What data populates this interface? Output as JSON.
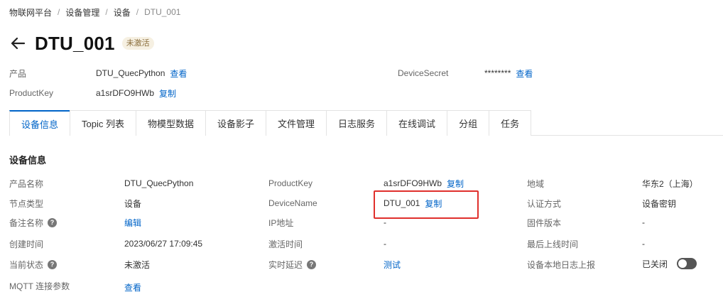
{
  "breadcrumb": [
    "物联网平台",
    "设备管理",
    "设备",
    "DTU_001"
  ],
  "header": {
    "title": "DTU_001",
    "status": "未激活"
  },
  "summary": {
    "product_label": "产品",
    "product_value": "DTU_QuecPython",
    "product_link": "查看",
    "productkey_label": "ProductKey",
    "productkey_value": "a1srDFO9HWb",
    "productkey_link": "复制",
    "secret_label": "DeviceSecret",
    "secret_value": "********",
    "secret_link": "查看"
  },
  "tabs": [
    "设备信息",
    "Topic 列表",
    "物模型数据",
    "设备影子",
    "文件管理",
    "日志服务",
    "在线调试",
    "分组",
    "任务"
  ],
  "active_tab": "设备信息",
  "section_title": "设备信息",
  "info": {
    "product_name_label": "产品名称",
    "product_name_value": "DTU_QuecPython",
    "productkey_label": "ProductKey",
    "productkey_value": "a1srDFO9HWb",
    "productkey_link": "复制",
    "region_label": "地域",
    "region_value": "华东2（上海）",
    "node_type_label": "节点类型",
    "node_type_value": "设备",
    "devicename_label": "DeviceName",
    "devicename_value": "DTU_001",
    "devicename_link": "复制",
    "auth_label": "认证方式",
    "auth_value": "设备密钥",
    "remark_label": "备注名称",
    "remark_link": "编辑",
    "ip_label": "IP地址",
    "ip_value": "-",
    "firmware_label": "固件版本",
    "firmware_value": "-",
    "created_label": "创建时间",
    "created_value": "2023/06/27 17:09:45",
    "activated_label": "激活时间",
    "activated_value": "-",
    "last_online_label": "最后上线时间",
    "last_online_value": "-",
    "state_label": "当前状态",
    "state_value": "未激活",
    "latency_label": "实时延迟",
    "latency_link": "测试",
    "log_report_label": "设备本地日志上报",
    "log_report_value": "已关闭",
    "mqtt_label": "MQTT 连接参数",
    "mqtt_link": "查看"
  },
  "colors": {
    "link": "#0064c8",
    "highlight": "#e0302c",
    "tag_bg": "#f6f0e2"
  },
  "icons": {
    "back": "arrow-left-icon",
    "help": "question-circle-icon",
    "toggle": "toggle-switch-icon"
  }
}
